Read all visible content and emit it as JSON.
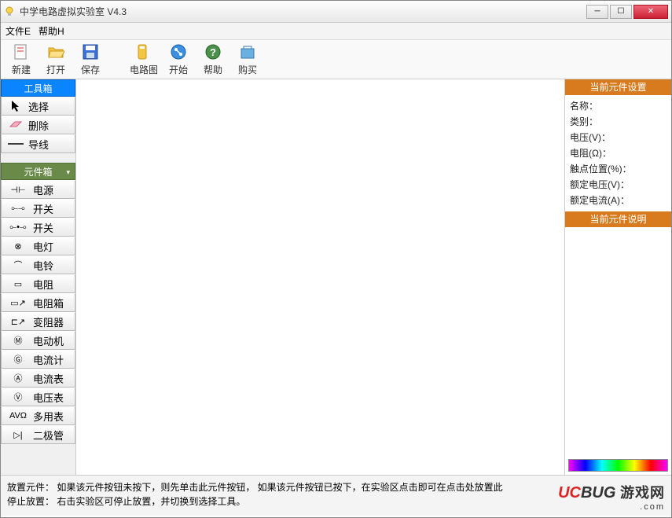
{
  "window": {
    "title": "中学电路虚拟实验室 V4.3"
  },
  "menu": {
    "file": "文件E",
    "help": "帮助H"
  },
  "toolbar": {
    "new": "新建",
    "open": "打开",
    "save": "保存",
    "circuit": "电路图",
    "start": "开始",
    "help": "帮助",
    "buy": "购买"
  },
  "toolbox": {
    "header": "工具箱",
    "select": "选择",
    "delete": "删除",
    "wire": "导线"
  },
  "components": {
    "header": "元件箱",
    "items": [
      {
        "sym": "⊣⊢",
        "label": "电源"
      },
      {
        "sym": "⟜⊸",
        "label": "开关"
      },
      {
        "sym": "⟜•⊸",
        "label": "开关"
      },
      {
        "sym": "⊗",
        "label": "电灯"
      },
      {
        "sym": "⌒",
        "label": "电铃"
      },
      {
        "sym": "▭",
        "label": "电阻"
      },
      {
        "sym": "▭↗",
        "label": "电阻箱"
      },
      {
        "sym": "⊏↗",
        "label": "变阻器"
      },
      {
        "sym": "Ⓜ",
        "label": "电动机"
      },
      {
        "sym": "Ⓖ",
        "label": "电流计"
      },
      {
        "sym": "Ⓐ",
        "label": "电流表"
      },
      {
        "sym": "Ⓥ",
        "label": "电压表"
      },
      {
        "sym": "AVΩ",
        "label": "多用表"
      },
      {
        "sym": "▷|",
        "label": "二极管"
      }
    ]
  },
  "settings_panel": {
    "header": "当前元件设置",
    "rows": {
      "name": "名称：",
      "category": "类别：",
      "voltage": "电压(V)：",
      "resistance": "电阻(Ω)：",
      "contact": "触点位置(%)：",
      "rated_voltage": "额定电压(V)：",
      "rated_current": "额定电流(A)："
    }
  },
  "desc_panel": {
    "header": "当前元件说明"
  },
  "status": {
    "line1": "放置元件：  如果该元件按钮未按下，则先单击此元件按钮，  如果该元件按钮已按下，在实验区点击即可在点击处放置此",
    "line2": "停止放置：  右击实验区可停止放置，并切换到选择工具。"
  },
  "watermark": {
    "brand1": "UC",
    "brand2": "BUG",
    "cn": "游戏网",
    "dom": ".com"
  }
}
